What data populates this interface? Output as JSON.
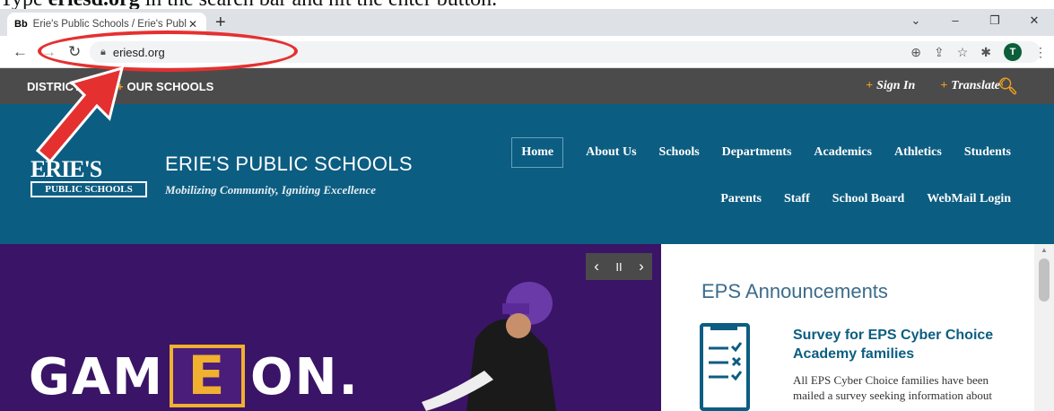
{
  "instruction": {
    "prefix": "Type ",
    "bold": "eriesd.org",
    "suffix": " in the search bar and hit the enter button."
  },
  "browser": {
    "tab_favicon": "Bb",
    "tab_title": "Erie's Public Schools / Erie's Publ",
    "url": "eriesd.org",
    "window_controls": [
      "⌄",
      "–",
      "❐",
      "✕"
    ],
    "profile_initial": "T"
  },
  "topnav": {
    "left": [
      "DISTRICT",
      "OUR SCHOOLS"
    ],
    "right": [
      "Sign In",
      "Translate"
    ]
  },
  "site": {
    "logo_main": "ERIE'S",
    "logo_sub": "PUBLIC SCHOOLS",
    "name": "ERIE'S PUBLIC SCHOOLS",
    "tagline": "Mobilizing Community, Igniting Excellence"
  },
  "mainnav": [
    "Home",
    "About Us",
    "Schools",
    "Departments",
    "Academics",
    "Athletics",
    "Students"
  ],
  "subnav": [
    "Parents",
    "Staff",
    "School Board",
    "WebMail Login"
  ],
  "hero": {
    "word1": "GAM",
    "letter": "E",
    "word2": "ON."
  },
  "slider": {
    "prev": "‹",
    "pause": "II",
    "next": "›"
  },
  "announcements": {
    "title": "EPS Announcements",
    "item_title": "Survey for EPS Cyber Choice Academy families",
    "item_body": "All EPS Cyber Choice families have been mailed a survey seeking information about ..."
  },
  "colors": {
    "header": "#0c5d82",
    "topnav": "#4b4b4b",
    "hero": "#3a1466",
    "accent": "#f0a020",
    "annotation": "#e53030"
  }
}
